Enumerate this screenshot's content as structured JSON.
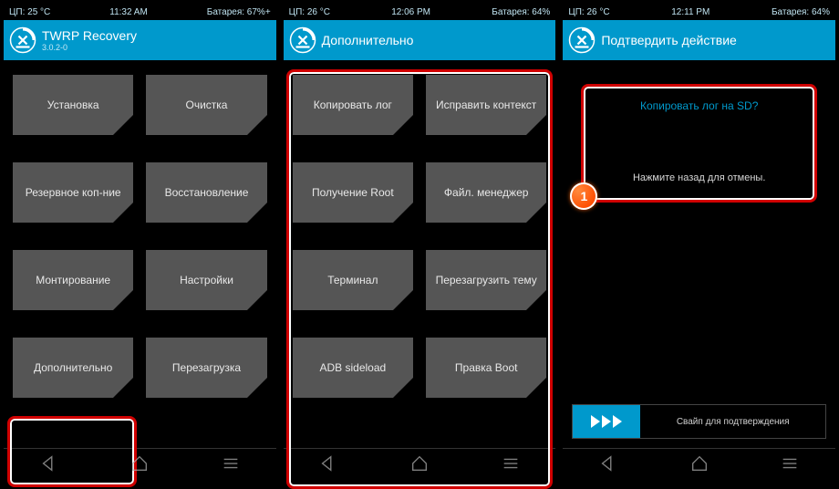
{
  "screens": [
    {
      "status": {
        "cpu": "ЦП: 25 °C",
        "time": "11:32 AM",
        "battery": "Батарея: 67%+"
      },
      "header": {
        "title": "TWRP Recovery",
        "sub": "3.0.2-0"
      },
      "tiles": [
        "Установка",
        "Очистка",
        "Резервное коп-ние",
        "Восстановление",
        "Монтирование",
        "Настройки",
        "Дополнительно",
        "Перезагрузка"
      ]
    },
    {
      "status": {
        "cpu": "ЦП: 26 °C",
        "time": "12:06 PM",
        "battery": "Батарея: 64%"
      },
      "header": {
        "title": "Дополнительно"
      },
      "tiles": [
        "Копировать лог",
        "Исправить контекст",
        "Получение Root",
        "Файл. менеджер",
        "Терминал",
        "Перезагрузить тему",
        "ADB sideload",
        "Правка Boot"
      ]
    },
    {
      "status": {
        "cpu": "ЦП: 26 °C",
        "time": "12:11 PM",
        "battery": "Батарея: 64%"
      },
      "header": {
        "title": "Подтвердить действие"
      },
      "confirm": {
        "question": "Копировать лог на SD?",
        "cancel": "Нажмите назад для отмены."
      },
      "badge": "1",
      "swipe": "Свайп для подтверждения"
    }
  ]
}
